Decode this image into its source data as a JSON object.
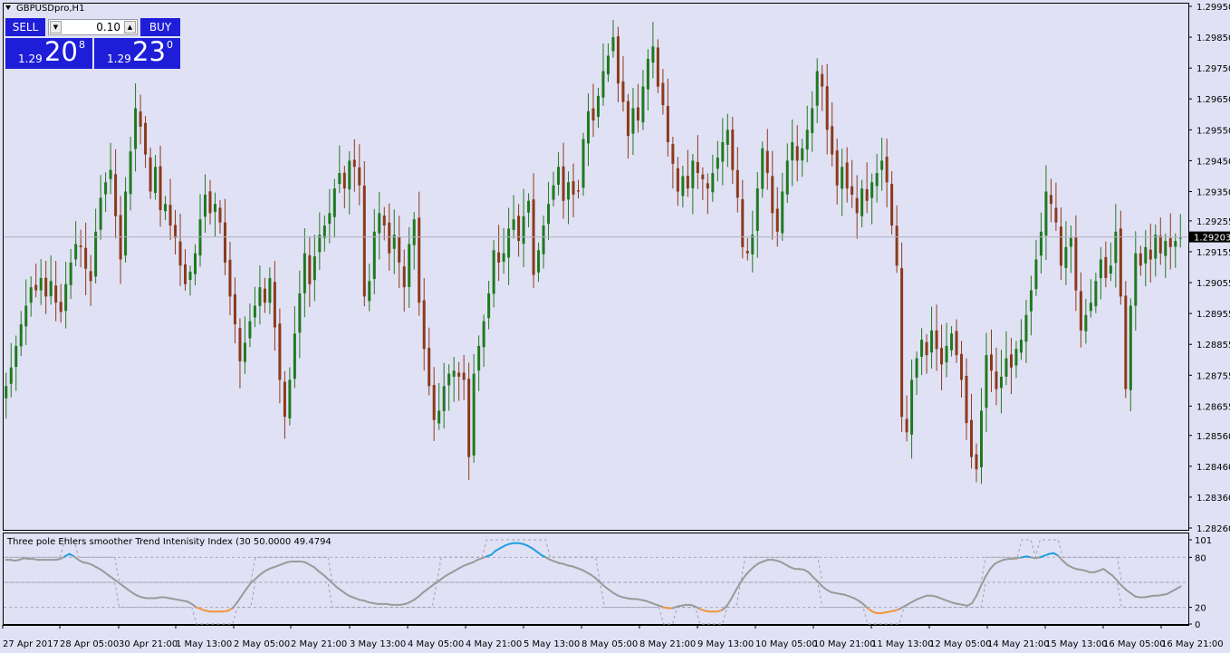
{
  "window": {
    "title": "GBPUSDpro,H1"
  },
  "trade_panel": {
    "sell_label": "SELL",
    "buy_label": "BUY",
    "lot": "0.10",
    "bid_prefix": "1.29",
    "bid_big": "20",
    "bid_sup": "8",
    "ask_prefix": "1.29",
    "ask_big": "23",
    "ask_sup": "0"
  },
  "colors": {
    "background": "#e1e1f5",
    "bull": "#1f7a1f",
    "bear": "#8b3a1a",
    "tti_line": "#9a9a9a",
    "tti_up": "#1ea0e0",
    "tti_down": "#f0963c",
    "price_tag": "#000000"
  },
  "indicator_panel": {
    "title": "Three pole Ehlers smoother Trend Intenisity Index (30 50.0000 49.4794"
  },
  "chart_data": [
    {
      "type": "candlestick",
      "symbol": "GBPUSDpro",
      "timeframe": "H1",
      "ylim": [
        1.2826,
        1.2995
      ],
      "y_ticks": [
        "1.29950",
        "1.29850",
        "1.29750",
        "1.29650",
        "1.29550",
        "1.29450",
        "1.29350",
        "1.29255",
        "1.29155",
        "1.29055",
        "1.28955",
        "1.28855",
        "1.28755",
        "1.28655",
        "1.28560",
        "1.28460",
        "1.28360",
        "1.28260"
      ],
      "current_price": "1.29203",
      "x_ticks": [
        "27 Apr 2017",
        "28 Apr 05:00",
        "30 Apr 21:00",
        "1 May 13:00",
        "2 May 05:00",
        "2 May 21:00",
        "3 May 13:00",
        "4 May 05:00",
        "4 May 21:00",
        "5 May 13:00",
        "8 May 05:00",
        "8 May 21:00",
        "9 May 13:00",
        "10 May 05:00",
        "10 May 21:00",
        "11 May 13:00",
        "12 May 05:00",
        "14 May 21:00",
        "15 May 13:00",
        "16 May 05:00",
        "16 May 21:00"
      ],
      "closes": [
        1.2872,
        1.2878,
        1.2885,
        1.2892,
        1.2898,
        1.2904,
        1.2903,
        1.2907,
        1.2901,
        1.2906,
        1.2899,
        1.2896,
        1.2905,
        1.2912,
        1.2918,
        1.2917,
        1.291,
        1.2906,
        1.2922,
        1.2933,
        1.2938,
        1.2942,
        1.2927,
        1.2913,
        1.2935,
        1.2948,
        1.2962,
        1.2956,
        1.2947,
        1.2935,
        1.2943,
        1.2929,
        1.2931,
        1.2924,
        1.292,
        1.2911,
        1.2905,
        1.2909,
        1.2915,
        1.2926,
        1.2934,
        1.2928,
        1.2931,
        1.2925,
        1.2912,
        1.2901,
        1.2892,
        1.288,
        1.2886,
        1.2893,
        1.2898,
        1.2904,
        1.2899,
        1.2907,
        1.2891,
        1.2874,
        1.2862,
        1.2874,
        1.2889,
        1.2902,
        1.2915,
        1.2905,
        1.2914,
        1.2921,
        1.2924,
        1.2928,
        1.2936,
        1.2941,
        1.2936,
        1.2945,
        1.2943,
        1.2937,
        1.2901,
        1.2906,
        1.2922,
        1.2928,
        1.2924,
        1.2915,
        1.2921,
        1.2912,
        1.2904,
        1.2918,
        1.2926,
        1.2899,
        1.2884,
        1.2872,
        1.2861,
        1.2864,
        1.2872,
        1.2876,
        1.2877,
        1.2875,
        1.2874,
        1.2849,
        1.2876,
        1.2885,
        1.2893,
        1.2902,
        1.2916,
        1.2912,
        1.2915,
        1.2923,
        1.2926,
        1.2919,
        1.2927,
        1.2932,
        1.2908,
        1.2916,
        1.2924,
        1.2931,
        1.2937,
        1.2943,
        1.2932,
        1.2938,
        1.2934,
        1.2935,
        1.2952,
        1.2961,
        1.2958,
        1.2966,
        1.2974,
        1.2979,
        1.2985,
        1.297,
        1.2964,
        1.2953,
        1.2962,
        1.2958,
        1.2969,
        1.2978,
        1.2982,
        1.2969,
        1.2963,
        1.2951,
        1.2944,
        1.2935,
        1.294,
        1.2936,
        1.2945,
        1.2941,
        1.2939,
        1.2936,
        1.2941,
        1.2946,
        1.2951,
        1.2955,
        1.2942,
        1.2933,
        1.2917,
        1.2915,
        1.2921,
        1.2936,
        1.2949,
        1.2941,
        1.2928,
        1.2922,
        1.2935,
        1.2945,
        1.2951,
        1.2945,
        1.2949,
        1.2955,
        1.2962,
        1.2974,
        1.2969,
        1.2955,
        1.2947,
        1.2937,
        1.2943,
        1.2936,
        1.2934,
        1.2928,
        1.2936,
        1.2932,
        1.2938,
        1.2941,
        1.2945,
        1.2938,
        1.2924,
        1.2911,
        1.2862,
        1.2857,
        1.2874,
        1.2881,
        1.2887,
        1.2882,
        1.289,
        1.2884,
        1.2879,
        1.2885,
        1.2889,
        1.2882,
        1.2874,
        1.286,
        1.2849,
        1.2845,
        1.2864,
        1.2882,
        1.2877,
        1.2871,
        1.2875,
        1.2881,
        1.2878,
        1.2884,
        1.2887,
        1.2895,
        1.2903,
        1.2913,
        1.2922,
        1.2935,
        1.2931,
        1.2925,
        1.2911,
        1.2917,
        1.292,
        1.2903,
        1.289,
        1.2895,
        1.2899,
        1.2906,
        1.2913,
        1.2907,
        1.2911,
        1.2922,
        1.2901,
        1.2871,
        1.2898,
        1.2915,
        1.2911,
        1.2917,
        1.2913,
        1.2921,
        1.2915,
        1.2919,
        1.2917,
        1.2919,
        1.292
      ]
    },
    {
      "type": "line",
      "name": "Three pole Ehlers smoother Trend Intenisity Index",
      "ylim": [
        0,
        101
      ],
      "y_ticks": [
        "101",
        "80",
        "20",
        "0"
      ],
      "levels": [
        80,
        50,
        20
      ],
      "series": [
        {
          "values": [
            77,
            77,
            76,
            77,
            79,
            78,
            78,
            77,
            77,
            77,
            77,
            77,
            78,
            81,
            84,
            81,
            77,
            74,
            73,
            71,
            68,
            65,
            61,
            57,
            53,
            49,
            45,
            41,
            37,
            34,
            32,
            31,
            31,
            31,
            32,
            32,
            31,
            30,
            29,
            28,
            27,
            24,
            20,
            18,
            16,
            15,
            15,
            15,
            15,
            16,
            19,
            26,
            34,
            42,
            49,
            54,
            59,
            63,
            66,
            68,
            70,
            72,
            74,
            75,
            75,
            75,
            74,
            71,
            68,
            63,
            59,
            54,
            49,
            44,
            40,
            36,
            33,
            31,
            29,
            28,
            26,
            25,
            24,
            24,
            24,
            23,
            23,
            23,
            24,
            26,
            29,
            33,
            38,
            42,
            46,
            50,
            54,
            58,
            61,
            64,
            67,
            70,
            72,
            74,
            77,
            79,
            81,
            83,
            88,
            91,
            94,
            96,
            97,
            97,
            96,
            94,
            91,
            87,
            83,
            80,
            77,
            75,
            73,
            72,
            70,
            69,
            67,
            65,
            62,
            59,
            55,
            50,
            45,
            41,
            37,
            34,
            32,
            31,
            30,
            30,
            29,
            28,
            26,
            24,
            22,
            20,
            19,
            19,
            21,
            22,
            23,
            23,
            21,
            18,
            16,
            15,
            15,
            15,
            17,
            22,
            31,
            41,
            50,
            58,
            64,
            69,
            73,
            75,
            77,
            77,
            76,
            74,
            71,
            68,
            66,
            66,
            65,
            62,
            56,
            51,
            45,
            41,
            38,
            37,
            36,
            35,
            33,
            31,
            28,
            24,
            19,
            15,
            13,
            13,
            14,
            15,
            16,
            18,
            21,
            24,
            27,
            30,
            32,
            34,
            34,
            33,
            31,
            29,
            27,
            25,
            24,
            23,
            22,
            25,
            34,
            46,
            57,
            66,
            72,
            75,
            77,
            78,
            78,
            79,
            80,
            81,
            80,
            79,
            80,
            82,
            84,
            85,
            82,
            76,
            71,
            68,
            66,
            65,
            64,
            62,
            62,
            64,
            66,
            62,
            58,
            52,
            46,
            41,
            37,
            33,
            32,
            32,
            33,
            34,
            34,
            35,
            36,
            39,
            42,
            45
          ]
        }
      ]
    }
  ]
}
